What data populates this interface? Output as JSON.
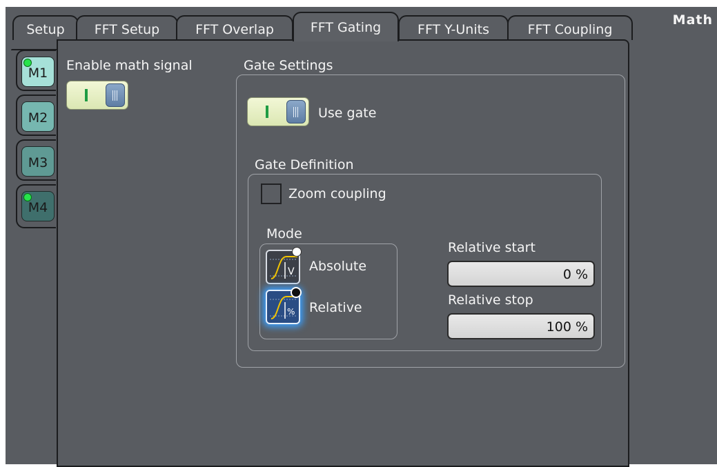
{
  "window": {
    "title": "Math"
  },
  "tabs": [
    {
      "label": "Setup"
    },
    {
      "label": "FFT Setup"
    },
    {
      "label": "FFT Overlap"
    },
    {
      "label": "FFT Gating"
    },
    {
      "label": "FFT Y-Units"
    },
    {
      "label": "FFT Coupling"
    }
  ],
  "active_tab": "FFT Gating",
  "side_tabs": [
    {
      "label": "M1",
      "enabled": true,
      "color": "#a6e0d8"
    },
    {
      "label": "M2",
      "enabled": false,
      "color": "#76b7b0"
    },
    {
      "label": "M3",
      "enabled": false,
      "color": "#5f9a94"
    },
    {
      "label": "M4",
      "enabled": true,
      "color": "#3f6f6c",
      "selected": true
    }
  ],
  "enable_math": {
    "label": "Enable math signal",
    "state": "on"
  },
  "gate_settings": {
    "title": "Gate Settings",
    "use_gate": {
      "label": "Use gate",
      "state": "on"
    },
    "gate_definition": {
      "title": "Gate Definition",
      "zoom_coupling": {
        "label": "Zoom coupling",
        "checked": false
      },
      "mode": {
        "label": "Mode",
        "options": [
          {
            "label": "Absolute",
            "icon": "absolute-gate-icon",
            "symbol": "V"
          },
          {
            "label": "Relative",
            "icon": "relative-gate-icon",
            "symbol": "%"
          }
        ],
        "selected": "Relative"
      },
      "relative_start": {
        "label": "Relative start",
        "value": "0 %"
      },
      "relative_stop": {
        "label": "Relative stop",
        "value": "100 %"
      }
    }
  },
  "colors": {
    "background": "#595c61",
    "toggle_on": "#1f9c43",
    "selection_glow": "#3aa0ff"
  }
}
